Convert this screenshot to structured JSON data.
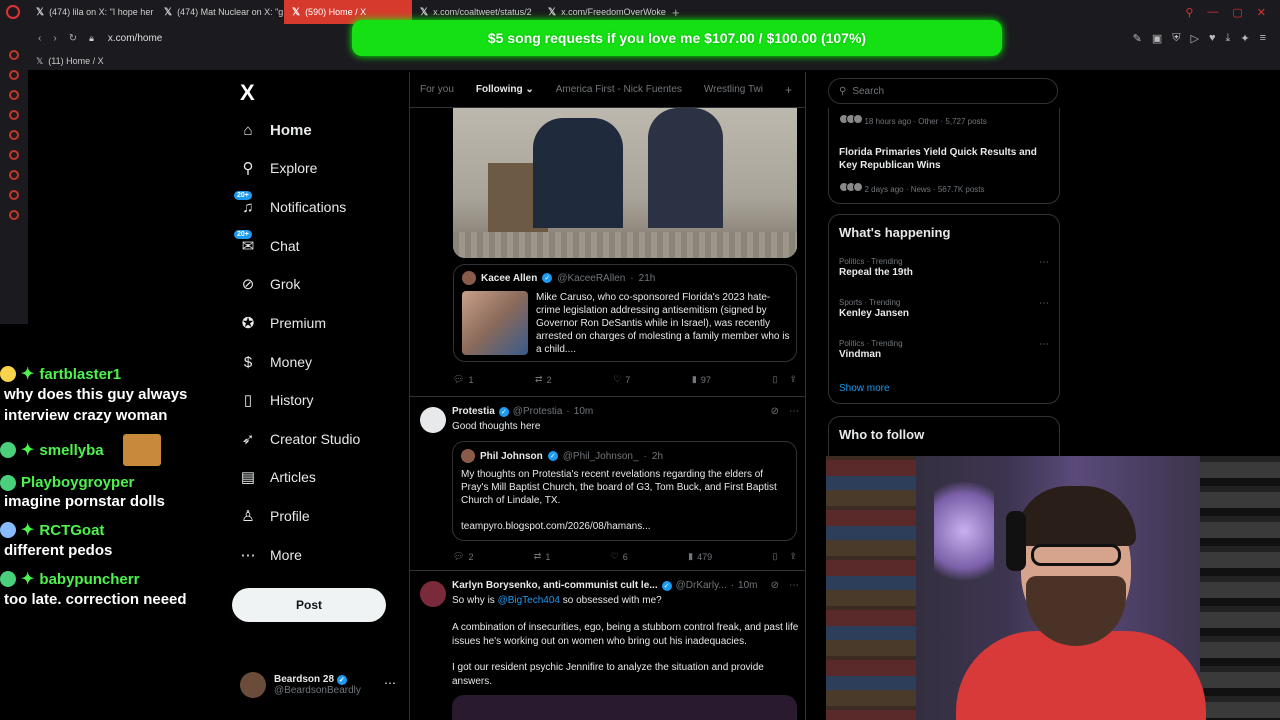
{
  "browser": {
    "tabs": [
      {
        "label": "(474) lila on X: \"I hope her"
      },
      {
        "label": "(474) Mat Nuclear on X: \"g"
      },
      {
        "label": "(590) Home / X",
        "active": true
      },
      {
        "label": "x.com/coaltweet/status/2"
      },
      {
        "label": "x.com/FreedomOverWoke"
      }
    ],
    "url": "x.com/home",
    "subtab": "(11) Home / X"
  },
  "banner": "$5 song requests if you love me $107.00 / $100.00 (107%)",
  "chat": [
    {
      "user": "fartblaster1",
      "text": "why does this guy always interview crazy woman",
      "badge_color": "#f7d44c"
    },
    {
      "user": "smellyba",
      "text": "",
      "badge_color": "#4ccf7c",
      "thumb": true
    },
    {
      "user": "Playboygroyper",
      "text": "imagine pornstar dolls",
      "badge_color": "#4ccf7c"
    },
    {
      "user": "RCTGoat",
      "text": "different pedos",
      "badge_color": "#88bbff"
    },
    {
      "user": "babypuncherr",
      "text": "too late. correction neeed",
      "badge_color": "#4ccf7c"
    }
  ],
  "sidebar": {
    "logo": "X",
    "items": [
      {
        "label": "Home",
        "icon": "home-icon",
        "glyph": "⌂",
        "bold": true
      },
      {
        "label": "Explore",
        "icon": "search-icon",
        "glyph": "⚲"
      },
      {
        "label": "Notifications",
        "icon": "bell-icon",
        "glyph": "♫",
        "count": "20+"
      },
      {
        "label": "Chat",
        "icon": "mail-icon",
        "glyph": "✉",
        "count": "20+"
      },
      {
        "label": "Grok",
        "icon": "grok-icon",
        "glyph": "⊘"
      },
      {
        "label": "Premium",
        "icon": "verified-icon",
        "glyph": "✪"
      },
      {
        "label": "Money",
        "icon": "dollar-icon",
        "glyph": "$"
      },
      {
        "label": "History",
        "icon": "bookmark-icon",
        "glyph": "▯"
      },
      {
        "label": "Creator Studio",
        "icon": "rocket-icon",
        "glyph": "➶"
      },
      {
        "label": "Articles",
        "icon": "article-icon",
        "glyph": "▤"
      },
      {
        "label": "Profile",
        "icon": "person-icon",
        "glyph": "♙"
      },
      {
        "label": "More",
        "icon": "more-icon",
        "glyph": "⋯"
      }
    ],
    "post_label": "Post",
    "account": {
      "name": "Beardson 28",
      "handle": "@BeardsonBeardly"
    }
  },
  "timeline": {
    "tabs": [
      "For you",
      "Following",
      "America First - Nick Fuentes",
      "Wrestling Twi"
    ],
    "active_tab": "Following",
    "quote1": {
      "name": "Kacee Allen",
      "handle": "@KaceeRAllen",
      "time": "21h",
      "text": "Mike Caruso, who co-sponsored Florida's 2023 hate-crime legislation addressing antisemitism (signed by Governor Ron DeSantis while in Israel), was recently arrested on charges of molesting a family member who is a child...."
    },
    "actions1": {
      "replies": "1",
      "reposts": "2",
      "likes": "7",
      "views": "97"
    },
    "post2": {
      "name": "Protestia",
      "handle": "@Protestia",
      "time": "10m",
      "text": "Good thoughts here",
      "quote": {
        "name": "Phil Johnson",
        "handle": "@Phil_Johnson_",
        "time": "2h",
        "text": "My thoughts on Protestia's recent revelations regarding the elders of Pray's Mill Baptist Church, the board of G3, Tom Buck, and First Baptist Church of Lindale, TX.",
        "link": "teampyro.blogspot.com/2026/08/hamans..."
      },
      "actions": {
        "replies": "2",
        "reposts": "1",
        "likes": "6",
        "views": "479"
      }
    },
    "post3": {
      "name": "Karlyn Borysenko, anti-communist cult le...",
      "handle": "@DrKarly...",
      "time": "10m",
      "line1_pre": "So why is ",
      "mention": "@BigTech404",
      "line1_post": " so obsessed with me?",
      "para2": "A combination of insecurities, ego, being a stubborn control freak, and past life issues he's working out on women who bring out his inadequacies.",
      "para3": "I got our resident psychic Jennifire to analyze the situation and provide answers."
    }
  },
  "right": {
    "search_placeholder": "Search",
    "top_meta1": "18 hours ago · Other · 5,727 posts",
    "top_title": "Florida Primaries Yield Quick Results and Key Republican Wins",
    "top_meta2": "2 days ago · News · 567.7K posts",
    "happening_title": "What's happening",
    "trends": [
      {
        "meta": "Politics · Trending",
        "title": "Repeal the 19th"
      },
      {
        "meta": "Sports · Trending",
        "title": "Kenley Jansen"
      },
      {
        "meta": "Politics · Trending",
        "title": "Vindman"
      }
    ],
    "show_more": "Show more",
    "who_to_follow": "Who to follow"
  }
}
